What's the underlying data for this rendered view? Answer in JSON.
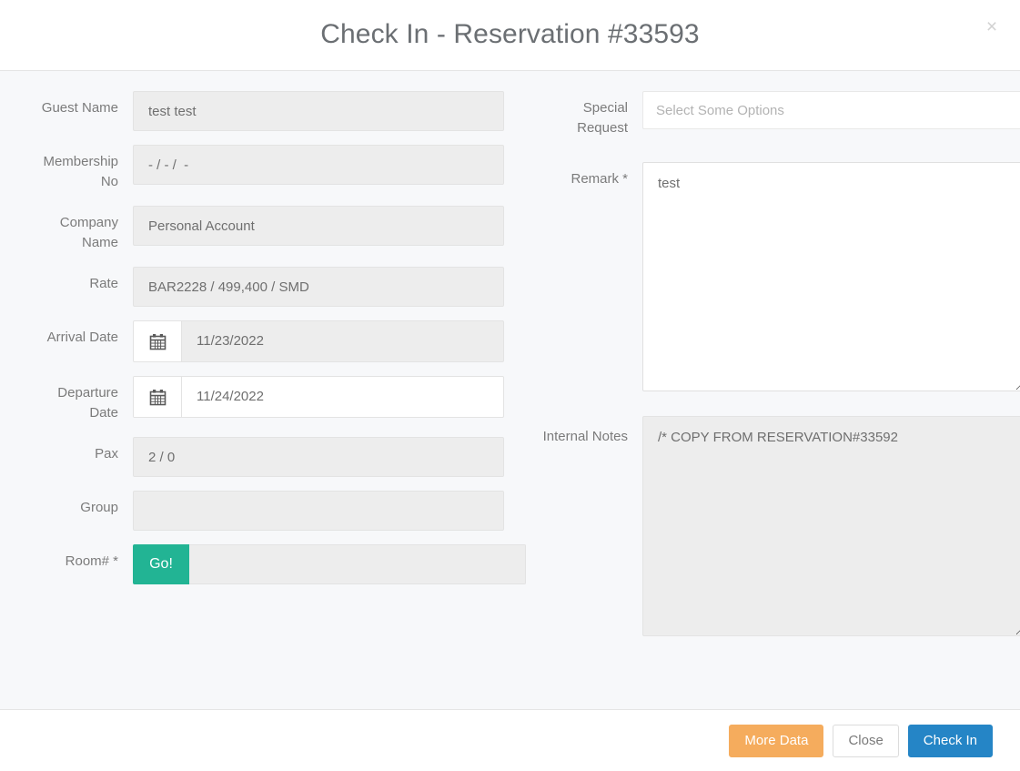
{
  "header": {
    "title": "Check In - Reservation #33593",
    "close_icon": "close-icon",
    "close_glyph": "×"
  },
  "left_column": {
    "fields": [
      {
        "label": "Guest Name",
        "value": "test test",
        "placeholder": "",
        "disabled": true
      },
      {
        "label": "Membership No",
        "value": "- / - /  -",
        "placeholder": "",
        "disabled": true
      },
      {
        "label": "Company Name",
        "value": "Personal Account",
        "placeholder": "",
        "disabled": true
      },
      {
        "label": "Rate",
        "value": "BAR2228 / 499,400 / SMD",
        "placeholder": "",
        "disabled": true
      },
      {
        "label": "Arrival Date",
        "value": "11/23/2022",
        "placeholder": "",
        "disabled": true,
        "icon": "calendar-icon"
      },
      {
        "label": "Departure Date",
        "value": "11/24/2022",
        "placeholder": "",
        "disabled": false,
        "icon": "calendar-icon"
      },
      {
        "label": "Pax",
        "value": "2 / 0",
        "placeholder": "",
        "disabled": true
      },
      {
        "label": "Group",
        "value": "",
        "placeholder": "",
        "disabled": true
      },
      {
        "label": "Room# *",
        "value": "",
        "placeholder": "",
        "disabled": true,
        "button_label": "Go!"
      }
    ]
  },
  "right_column": {
    "special_request": {
      "label": "Special Request",
      "value": "",
      "placeholder": "Select Some Options"
    },
    "remark": {
      "label": "Remark *",
      "value": "test",
      "placeholder": ""
    },
    "internal_notes": {
      "label": "Internal Notes",
      "value": "/* COPY FROM RESERVATION#33592",
      "placeholder": ""
    }
  },
  "footer": {
    "more_data_label": "More Data",
    "close_label": "Close",
    "check_in_label": "Check In"
  },
  "colors": {
    "accent_green": "#22b494",
    "accent_orange": "#f5ac5d",
    "accent_blue": "#2585c6",
    "body_bg": "#f7f8fa",
    "input_disabled_bg": "#ededed",
    "label_text": "#7b7b7b",
    "title_text": "#6b6f73"
  }
}
